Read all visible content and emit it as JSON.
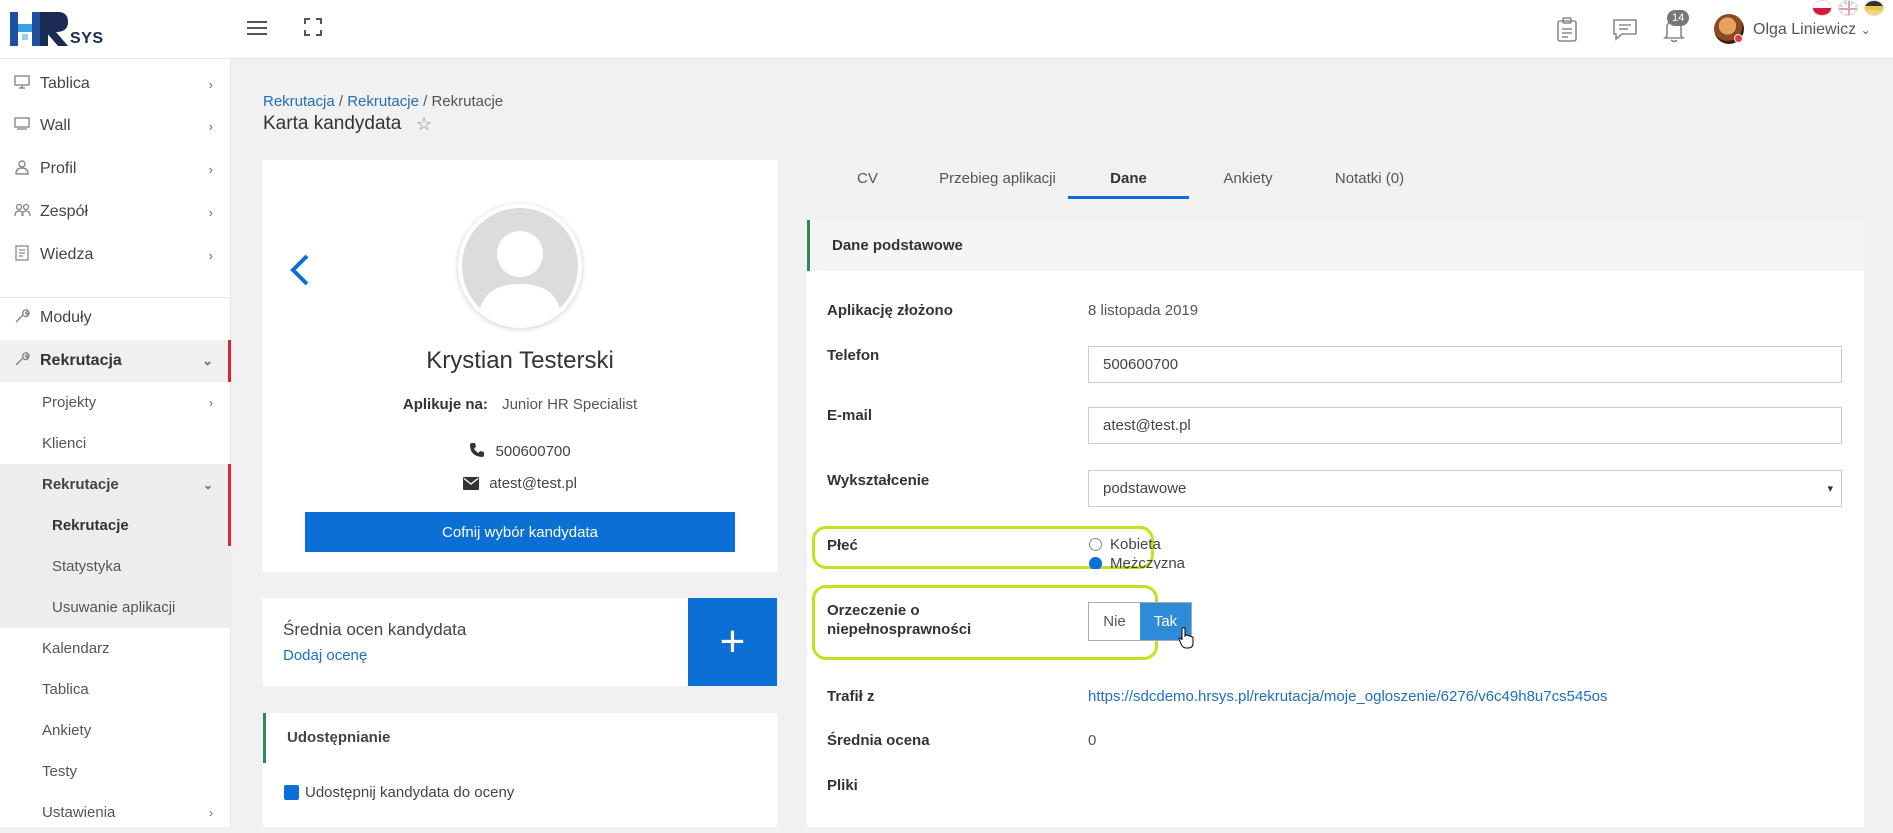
{
  "header": {
    "logo_text": "SYS",
    "notifications_count": "14",
    "user_name": "Olga Liniewicz",
    "user_chevron": "⌄"
  },
  "sidebar": {
    "items": [
      {
        "label": "Tablica",
        "icon": "monitor-icon"
      },
      {
        "label": "Wall",
        "icon": "wall-icon"
      },
      {
        "label": "Profil",
        "icon": "user-icon"
      },
      {
        "label": "Zespół",
        "icon": "team-icon"
      },
      {
        "label": "Wiedza",
        "icon": "book-icon"
      },
      {
        "label": "Moduły",
        "icon": "wrench-icon"
      },
      {
        "label": "Rekrutacja",
        "icon": "wrench-icon"
      }
    ],
    "sub": {
      "projekty": "Projekty",
      "klienci": "Klienci",
      "rekrutacje": "Rekrutacje",
      "rekrutacje_child": "Rekrutacje",
      "statystyka": "Statystyka",
      "usuwanie": "Usuwanie aplikacji",
      "kalendarz": "Kalendarz",
      "tablica": "Tablica",
      "ankiety": "Ankiety",
      "testy": "Testy",
      "ustawienia": "Ustawienia"
    }
  },
  "breadcrumb": {
    "first": "Rekrutacja",
    "second": "Rekrutacje",
    "third": "Rekrutacje",
    "sep": "/"
  },
  "page_title": "Karta kandydata",
  "candidate": {
    "name": "Krystian Testerski",
    "applies_label": "Aplikuje na:",
    "applies_value": "Junior HR Specialist",
    "phone": "500600700",
    "email": "atest@test.pl",
    "cancel_button": "Cofnij wybór kandydata"
  },
  "rating": {
    "title": "Średnia ocen kandydata",
    "add_link": "Dodaj ocenę",
    "plus": "+"
  },
  "share": {
    "title": "Udostępnianie",
    "checkbox_label": "Udostępnij kandydata do oceny"
  },
  "tabs": [
    "CV",
    "Przebieg aplikacji",
    "Dane",
    "Ankiety",
    "Notatki (0)"
  ],
  "panel": {
    "title": "Dane podstawowe",
    "applied_label": "Aplikację złożono",
    "applied_value": "8 listopada 2019",
    "phone_label": "Telefon",
    "phone_value": "500600700",
    "email_label": "E-mail",
    "email_value": "atest@test.pl",
    "education_label": "Wykształcenie",
    "education_value": "podstawowe",
    "gender_label": "Płeć",
    "gender_options": [
      "Kobieta",
      "Mężczyzna"
    ],
    "disability_label_1": "Orzeczenie o",
    "disability_label_2": "niepełnosprawności",
    "toggle_no": "Nie",
    "toggle_yes": "Tak",
    "source_label": "Trafił z",
    "source_value": "https://sdcdemo.hrsys.pl/rekrutacja/moje_ogloszenie/6276/v6c49h8u7cs545os",
    "avg_label": "Średnia ocena",
    "avg_value": "0",
    "files_label": "Pliki"
  },
  "colors": {
    "primary": "#0b6fd6",
    "highlight": "#c5e01e",
    "accent_red": "#d9262f",
    "green_bar": "#2e8b57"
  }
}
